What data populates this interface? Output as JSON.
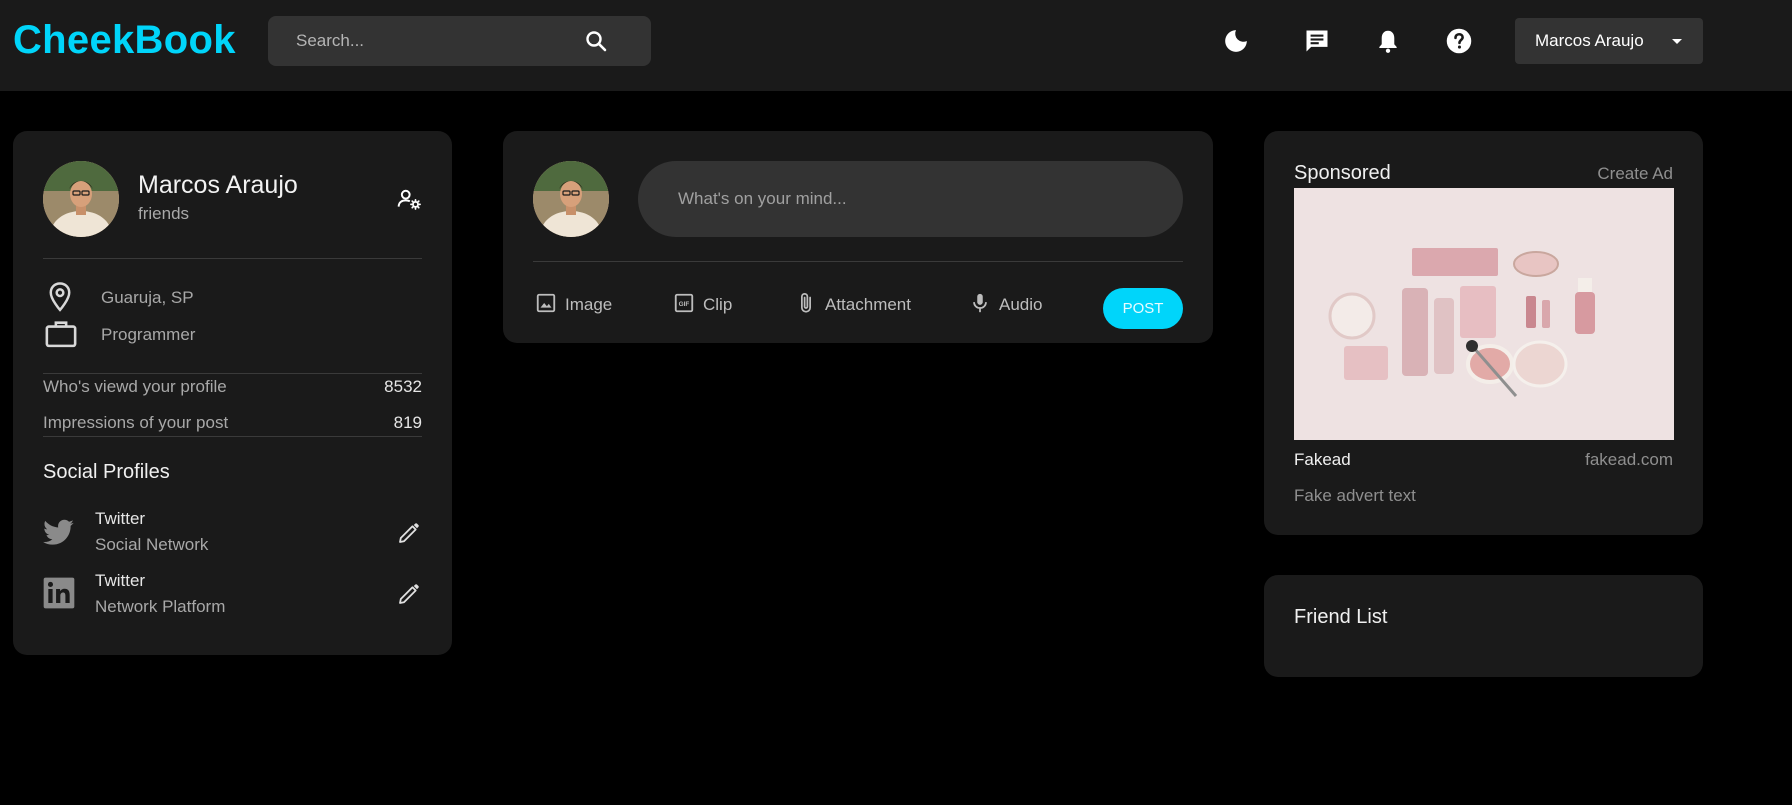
{
  "app": {
    "logo": "CheekBook"
  },
  "navbar": {
    "search_placeholder": "Search...",
    "icons": [
      "dark-mode-icon",
      "message-icon",
      "notification-icon",
      "help-icon"
    ],
    "user_select": "Marcos Araujo"
  },
  "profile": {
    "name": "Marcos Araujo",
    "subtitle": "friends",
    "location": "Guaruja, SP",
    "occupation": "Programmer",
    "stats": [
      {
        "label": "Who's viewd your profile",
        "value": "8532"
      },
      {
        "label": "Impressions of your post",
        "value": "819"
      }
    ],
    "social_title": "Social Profiles",
    "social": [
      {
        "name": "Twitter",
        "desc": "Social Network",
        "icon": "twitter-icon"
      },
      {
        "name": "Twitter",
        "desc": "Network Platform",
        "icon": "linkedin-icon"
      }
    ]
  },
  "composer": {
    "placeholder": "What's on your mind...",
    "actions": [
      {
        "label": "Image",
        "icon": "image-icon"
      },
      {
        "label": "Clip",
        "icon": "gif-icon"
      },
      {
        "label": "Attachment",
        "icon": "attachment-icon"
      },
      {
        "label": "Audio",
        "icon": "microphone-icon"
      }
    ],
    "post_label": "POST"
  },
  "sponsored": {
    "title": "Sponsored",
    "create_ad": "Create Ad",
    "ad_name": "Fakead",
    "ad_url": "fakead.com",
    "ad_text": "Fake advert text"
  },
  "friends": {
    "title": "Friend List"
  },
  "colors": {
    "accent": "#00d5fa",
    "card": "#1a1a1a",
    "background": "#000000",
    "input": "#333333"
  }
}
